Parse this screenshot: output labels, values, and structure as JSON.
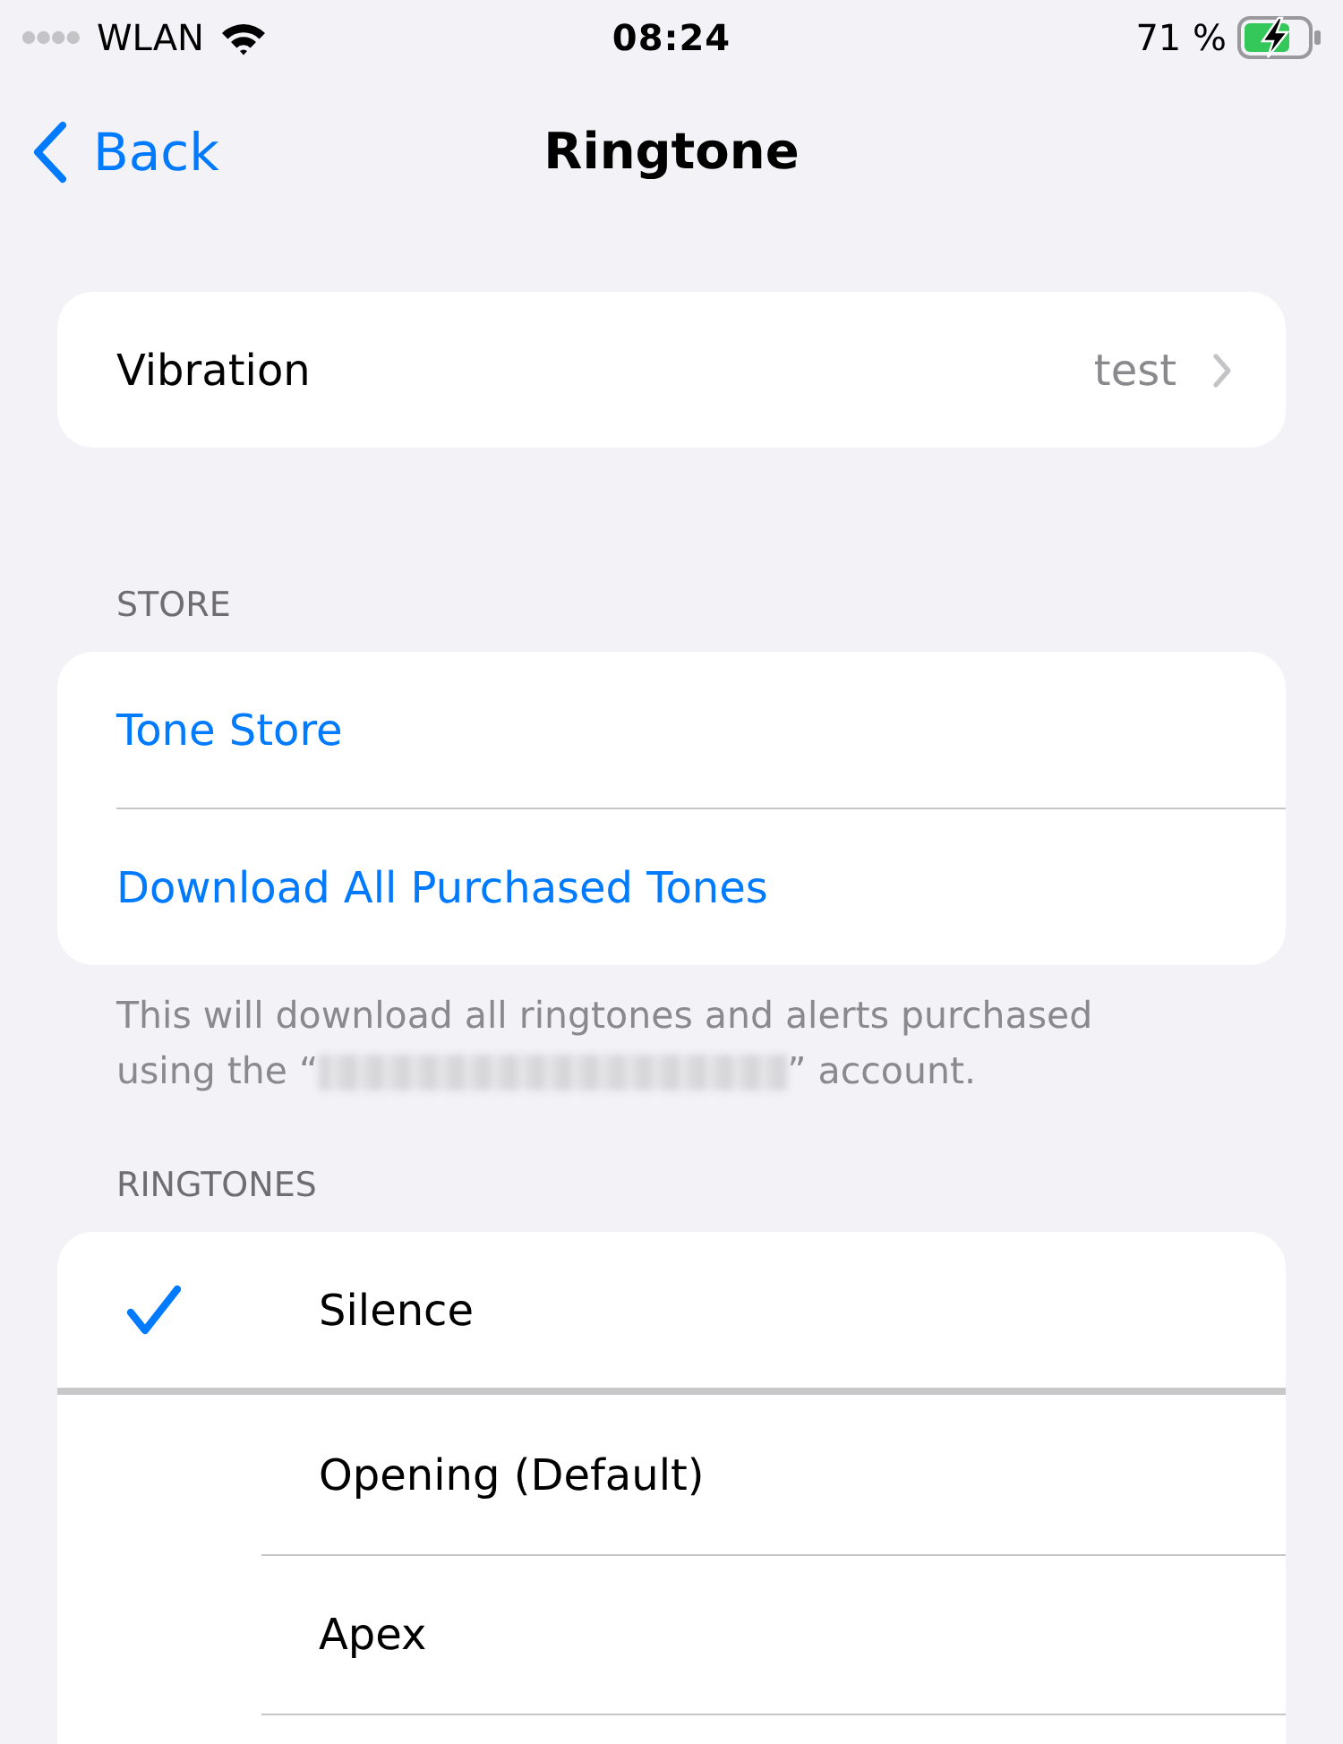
{
  "status_bar": {
    "carrier": "WLAN",
    "time": "08:24",
    "battery": "71 %"
  },
  "nav": {
    "back": "Back",
    "title": "Ringtone"
  },
  "vibration": {
    "label": "Vibration",
    "value": "test"
  },
  "store": {
    "header": "STORE",
    "items": [
      "Tone Store",
      "Download All Purchased Tones"
    ],
    "footer": {
      "text_line_1": "This will download all ringtones and alerts purchased",
      "text_before_redaction": "using the “",
      "redacted": true,
      "text_after_redaction": "” account."
    }
  },
  "ringtones": {
    "header": "RINGTONES",
    "groups": [
      {
        "items": [
          {
            "name": "Silence",
            "selected": true
          }
        ]
      },
      {
        "items": [
          {
            "name": "Opening (Default)",
            "selected": false
          },
          {
            "name": "Apex",
            "selected": false
          }
        ]
      }
    ]
  }
}
